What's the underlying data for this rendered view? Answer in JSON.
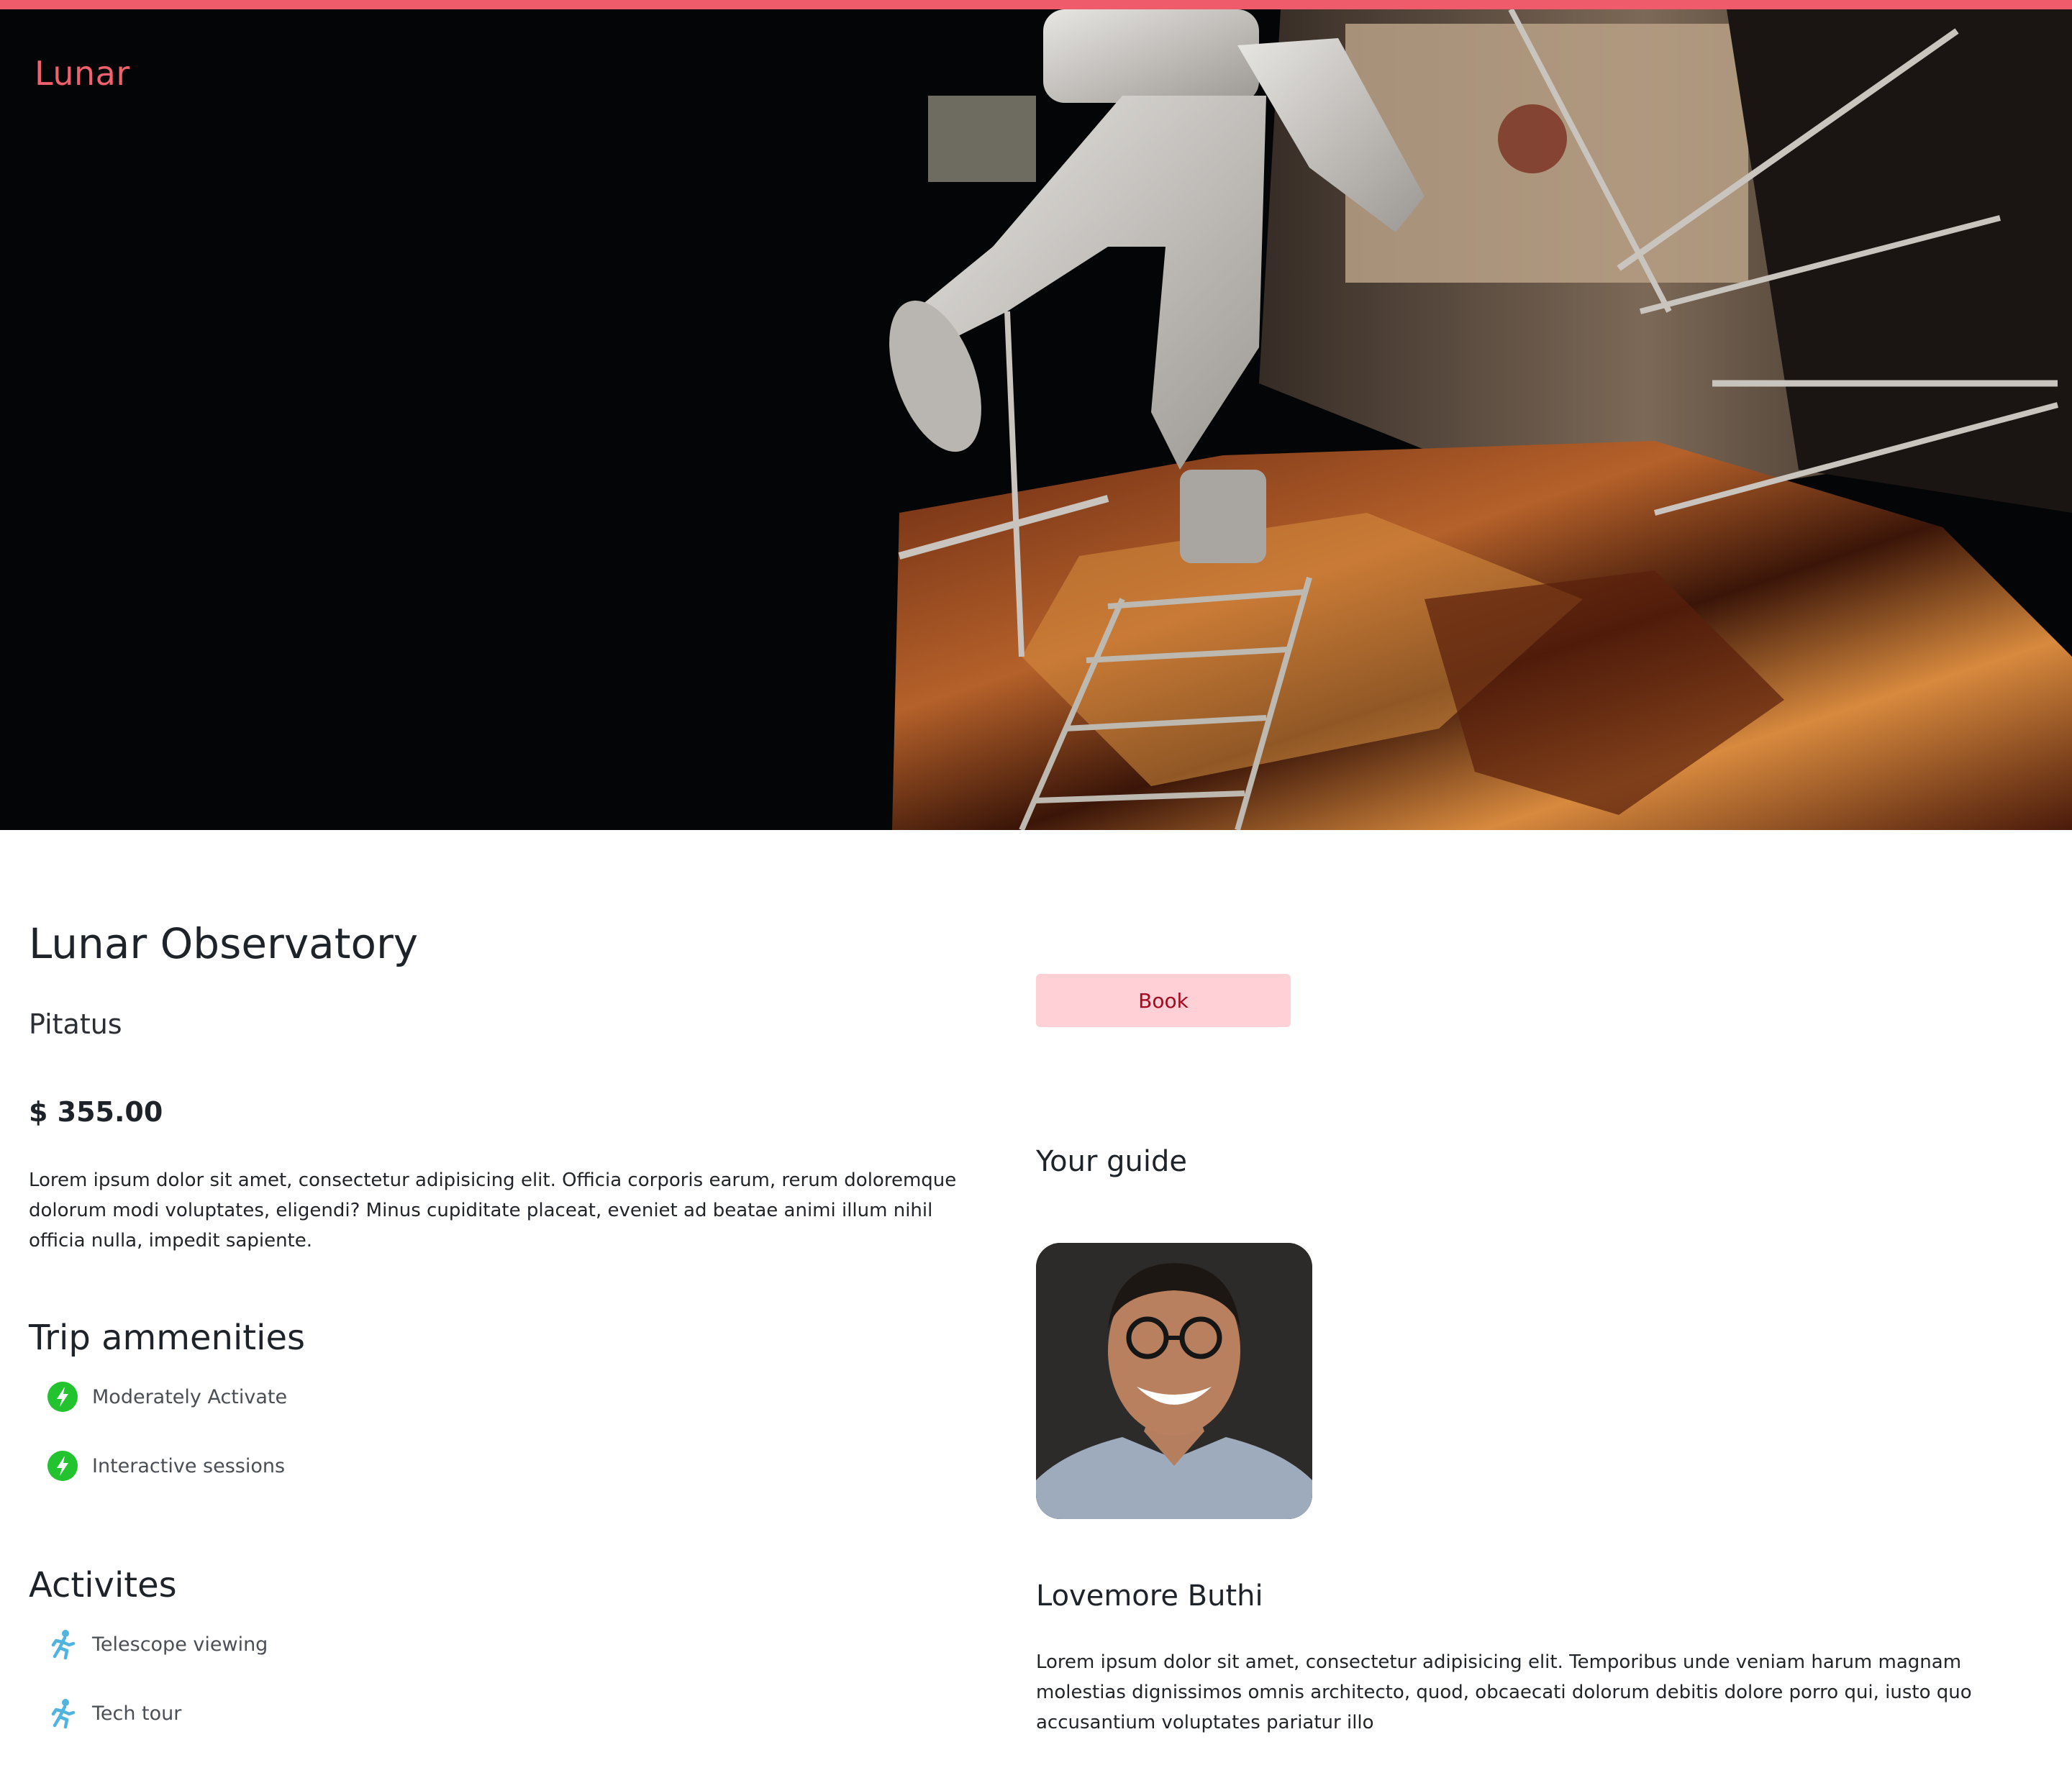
{
  "brand": "Lunar",
  "trip": {
    "title": "Lunar Observatory",
    "location": "Pitatus",
    "price": "$ 355.00",
    "description": "Lorem ipsum dolor sit amet, consectetur adipisicing elit. Officia corporis earum, rerum doloremque dolorum modi voluptates, eligendi? Minus cupiditate placeat, eveniet ad beatae animi illum nihil officia nulla, impedit sapiente."
  },
  "amenities": {
    "heading": "Trip ammenities",
    "items": [
      {
        "label": "Moderately Activate",
        "icon": "lightning-icon"
      },
      {
        "label": "Interactive sessions",
        "icon": "lightning-icon"
      }
    ]
  },
  "activities": {
    "heading": "Activites",
    "items": [
      {
        "label": "Telescope viewing",
        "icon": "running-person-icon"
      },
      {
        "label": "Tech tour",
        "icon": "running-person-icon"
      }
    ]
  },
  "booking": {
    "button_label": "Book"
  },
  "guide": {
    "heading": "Your guide",
    "name": "Lovemore Buthi",
    "bio": "Lorem ipsum dolor sit amet, consectetur adipisicing elit. Temporibus unde veniam harum magnam molestias dignissimos omnis architecto, quod, obcaecati dolorum debitis dolore porro qui, iusto quo accusantium voluptates pariatur illo"
  },
  "colors": {
    "accent": "#ef5b6a",
    "brand_text": "#f0606d",
    "book_bg": "#ffd0d5",
    "book_text": "#a30a1f",
    "amenity_icon": "#22c32f",
    "activity_icon": "#4fb5e0"
  }
}
